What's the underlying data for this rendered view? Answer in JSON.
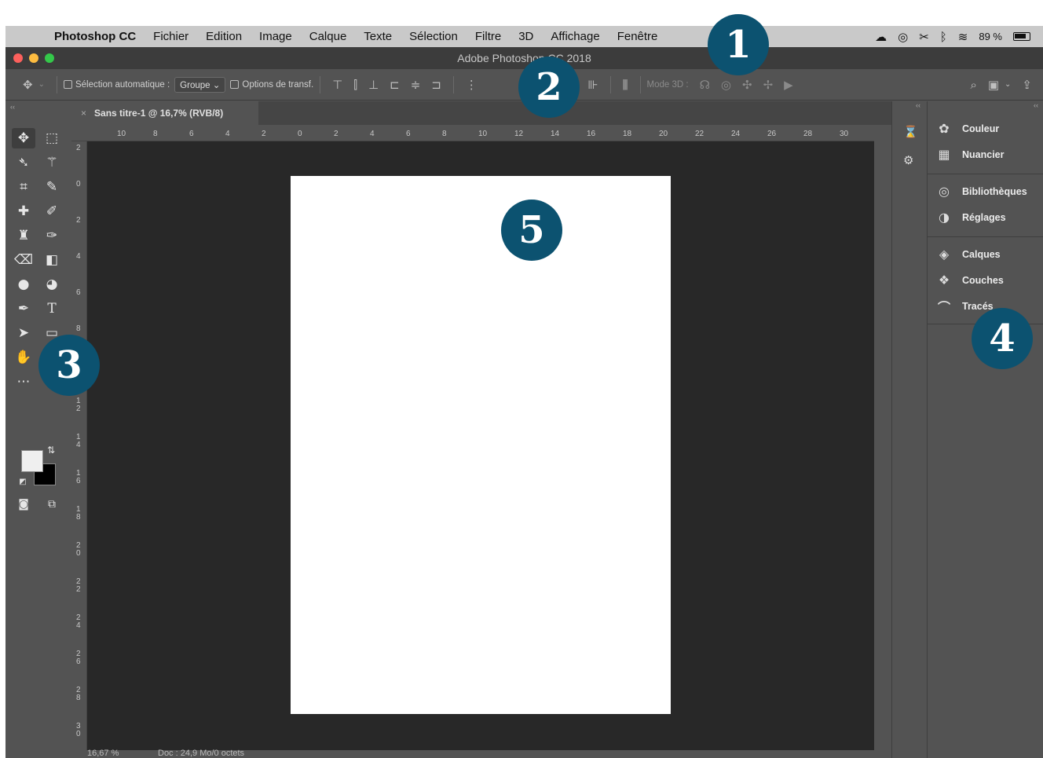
{
  "menubar": {
    "items": [
      "Photoshop CC",
      "Fichier",
      "Edition",
      "Image",
      "Calque",
      "Texte",
      "Sélection",
      "Filtre",
      "3D",
      "Affichage",
      "Fenêtre"
    ],
    "battery": "89 %"
  },
  "window": {
    "title": "Adobe Photoshop CC 2018"
  },
  "options": {
    "auto_select_label": "Sélection automatique :",
    "auto_select_value": "Groupe",
    "transform_label": "Options de transf.",
    "mode3d_label": "Mode 3D :"
  },
  "document": {
    "tab_label": "Sans titre-1 @ 16,7% (RVB/8)",
    "zoom": "16,67 %",
    "doc_info": "Doc : 24,9 Mo/0 octets"
  },
  "rulers": {
    "h_ticks": [
      "10",
      "8",
      "6",
      "4",
      "2",
      "0",
      "2",
      "4",
      "6",
      "8",
      "10",
      "12",
      "14",
      "16",
      "18",
      "20",
      "22",
      "24",
      "26",
      "28",
      "30"
    ],
    "v_ticks": [
      "2",
      "0",
      "2",
      "4",
      "6",
      "8",
      "1\n0",
      "1\n2",
      "1\n4",
      "1\n6",
      "1\n8",
      "2\n0",
      "2\n2",
      "2\n4",
      "2\n6",
      "2\n8",
      "3\n0"
    ]
  },
  "panels": {
    "group1": [
      "Couleur",
      "Nuancier"
    ],
    "group2": [
      "Bibliothèques",
      "Réglages"
    ],
    "group3": [
      "Calques",
      "Couches",
      "Tracés"
    ]
  },
  "callouts": [
    "1",
    "2",
    "3",
    "4",
    "5"
  ],
  "colors": {
    "callout": "#0c5270",
    "menubar": "#c9c9c9",
    "panel": "#535353",
    "canvas_bg": "#282828",
    "close": "#fc605c",
    "minimize": "#fdbc40",
    "zoom": "#34c84a"
  }
}
